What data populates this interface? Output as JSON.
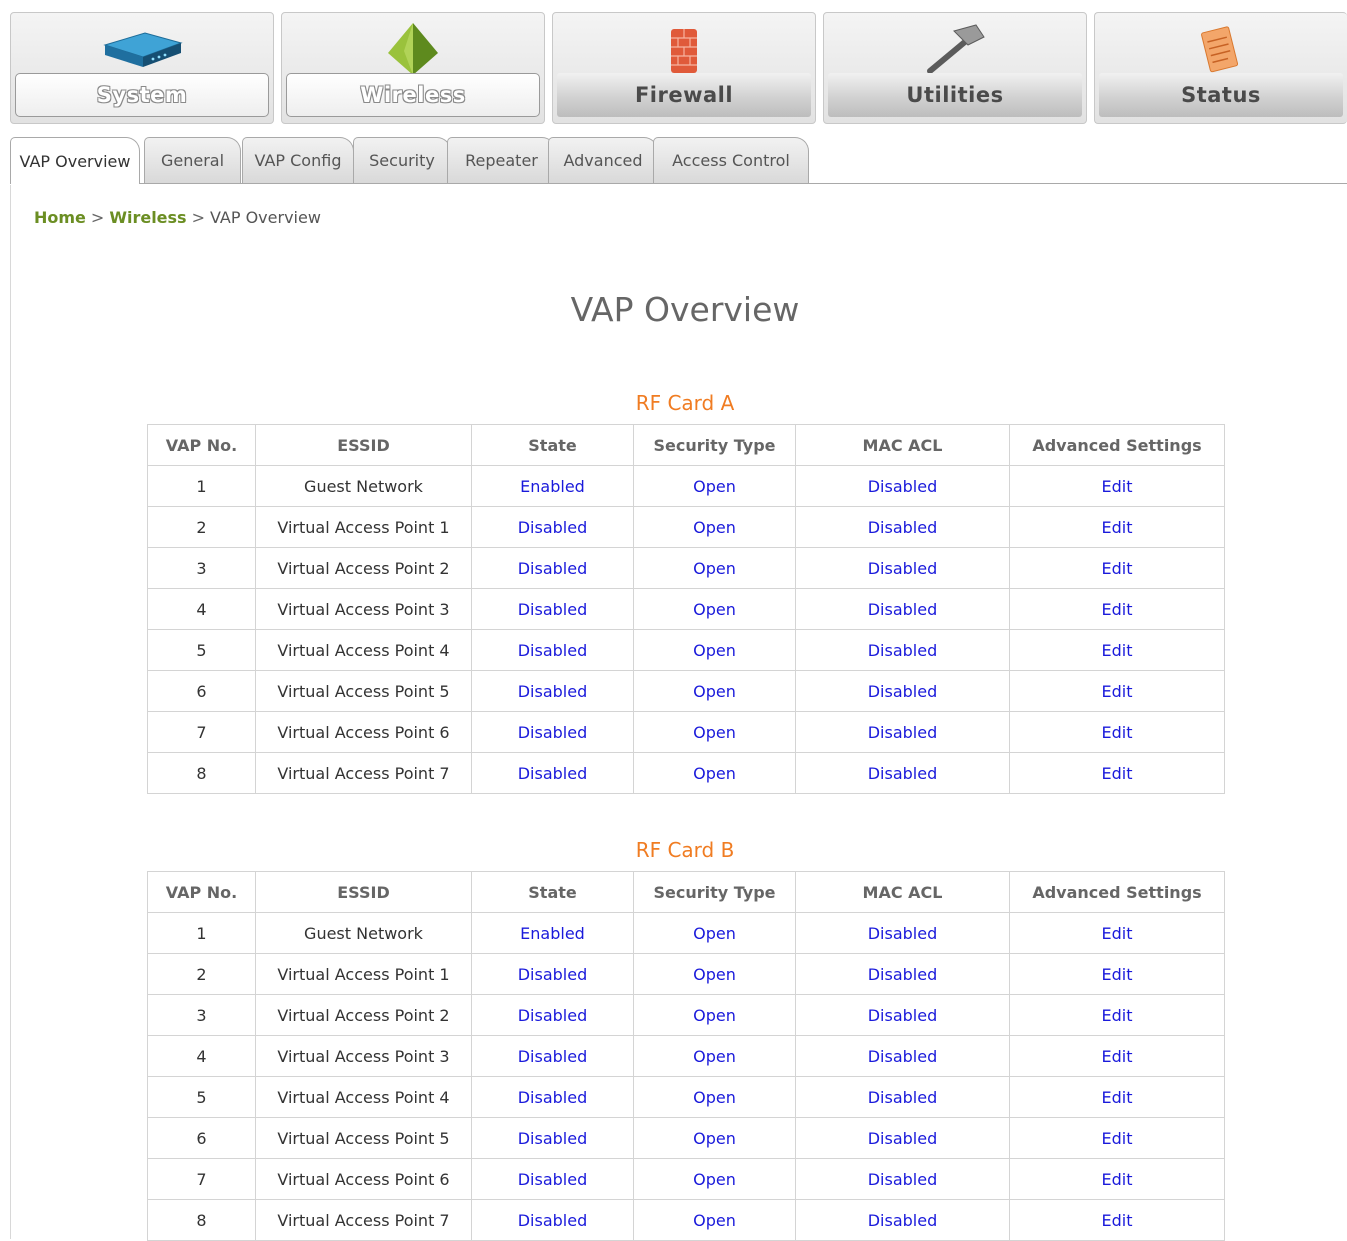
{
  "nav": [
    {
      "label": "System",
      "icon": "router-icon",
      "state": "inactive"
    },
    {
      "label": "Wireless",
      "icon": "wireless-pyramid-icon",
      "state": "inactive"
    },
    {
      "label": "Firewall",
      "icon": "firewall-brick-icon",
      "state": "active"
    },
    {
      "label": "Utilities",
      "icon": "hammer-icon",
      "state": "active"
    },
    {
      "label": "Status",
      "icon": "notepad-pencil-icon",
      "state": "active"
    }
  ],
  "tabs": [
    "VAP Overview",
    "General",
    "VAP Config",
    "Security",
    "Repeater",
    "Advanced",
    "Access Control"
  ],
  "active_tab": "VAP Overview",
  "breadcrumb": {
    "home": "Home",
    "sep": ">",
    "section": "Wireless",
    "current": "VAP Overview"
  },
  "page_title": "VAP Overview",
  "columns": [
    "VAP No.",
    "ESSID",
    "State",
    "Security Type",
    "MAC ACL",
    "Advanced Settings"
  ],
  "cards": [
    {
      "title": "RF Card A",
      "rows": [
        {
          "no": "1",
          "essid": "Guest Network",
          "state": "Enabled",
          "security": "Open",
          "mac_acl": "Disabled",
          "adv": "Edit"
        },
        {
          "no": "2",
          "essid": "Virtual Access Point 1",
          "state": "Disabled",
          "security": "Open",
          "mac_acl": "Disabled",
          "adv": "Edit"
        },
        {
          "no": "3",
          "essid": "Virtual Access Point 2",
          "state": "Disabled",
          "security": "Open",
          "mac_acl": "Disabled",
          "adv": "Edit"
        },
        {
          "no": "4",
          "essid": "Virtual Access Point 3",
          "state": "Disabled",
          "security": "Open",
          "mac_acl": "Disabled",
          "adv": "Edit"
        },
        {
          "no": "5",
          "essid": "Virtual Access Point 4",
          "state": "Disabled",
          "security": "Open",
          "mac_acl": "Disabled",
          "adv": "Edit"
        },
        {
          "no": "6",
          "essid": "Virtual Access Point 5",
          "state": "Disabled",
          "security": "Open",
          "mac_acl": "Disabled",
          "adv": "Edit"
        },
        {
          "no": "7",
          "essid": "Virtual Access Point 6",
          "state": "Disabled",
          "security": "Open",
          "mac_acl": "Disabled",
          "adv": "Edit"
        },
        {
          "no": "8",
          "essid": "Virtual Access Point 7",
          "state": "Disabled",
          "security": "Open",
          "mac_acl": "Disabled",
          "adv": "Edit"
        }
      ]
    },
    {
      "title": "RF Card B",
      "rows": [
        {
          "no": "1",
          "essid": "Guest Network",
          "state": "Enabled",
          "security": "Open",
          "mac_acl": "Disabled",
          "adv": "Edit"
        },
        {
          "no": "2",
          "essid": "Virtual Access Point 1",
          "state": "Disabled",
          "security": "Open",
          "mac_acl": "Disabled",
          "adv": "Edit"
        },
        {
          "no": "3",
          "essid": "Virtual Access Point 2",
          "state": "Disabled",
          "security": "Open",
          "mac_acl": "Disabled",
          "adv": "Edit"
        },
        {
          "no": "4",
          "essid": "Virtual Access Point 3",
          "state": "Disabled",
          "security": "Open",
          "mac_acl": "Disabled",
          "adv": "Edit"
        },
        {
          "no": "5",
          "essid": "Virtual Access Point 4",
          "state": "Disabled",
          "security": "Open",
          "mac_acl": "Disabled",
          "adv": "Edit"
        },
        {
          "no": "6",
          "essid": "Virtual Access Point 5",
          "state": "Disabled",
          "security": "Open",
          "mac_acl": "Disabled",
          "adv": "Edit"
        },
        {
          "no": "7",
          "essid": "Virtual Access Point 6",
          "state": "Disabled",
          "security": "Open",
          "mac_acl": "Disabled",
          "adv": "Edit"
        },
        {
          "no": "8",
          "essid": "Virtual Access Point 7",
          "state": "Disabled",
          "security": "Open",
          "mac_acl": "Disabled",
          "adv": "Edit"
        }
      ]
    }
  ],
  "colors": {
    "accent_orange": "#f07c22",
    "link_blue": "#1a1adb",
    "breadcrumb_green": "#6b8e23"
  }
}
